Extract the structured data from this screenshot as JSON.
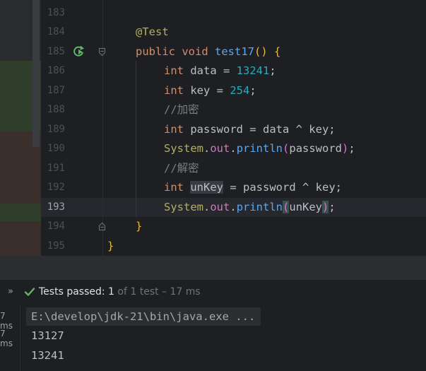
{
  "editor": {
    "line_numbers": [
      "183",
      "184",
      "185",
      "186",
      "187",
      "188",
      "189",
      "190",
      "191",
      "192",
      "193",
      "194",
      "195"
    ],
    "lines": {
      "l184_annotation": "@Test",
      "l185_public": "public",
      "l185_void": "void",
      "l185_name": "test17",
      "l185_parens": "()",
      "l185_brace": "{",
      "l186_type": "int",
      "l186_rest": " data = ",
      "l186_num": "13241",
      "l186_end": ";",
      "l187_type": "int",
      "l187_rest": " key = ",
      "l187_num": "254",
      "l187_end": ";",
      "l188_comment": "//加密",
      "l189_type": "int",
      "l189_rest": " password = data ^ key;",
      "l190_system": "System",
      "l190_dot1": ".",
      "l190_out": "out",
      "l190_dot2": ".",
      "l190_println": "println",
      "l190_lparen": "(",
      "l190_arg": "password",
      "l190_rparen": ")",
      "l190_end": ";",
      "l191_comment": "//解密",
      "l192_type": "int",
      "l192_sp": " ",
      "l192_var": "unKey",
      "l192_rest": " = password ^ key;",
      "l193_system": "System",
      "l193_dot1": ".",
      "l193_out": "out",
      "l193_dot2": ".",
      "l193_println": "println",
      "l193_lparen": "(",
      "l193_arg": "unKey",
      "l193_rparen": ")",
      "l193_end": ";",
      "l194_brace": "}",
      "l195_brace": "}"
    },
    "active_line": "193",
    "icons": {
      "run": "run-test-icon",
      "fold": "fold-icon"
    }
  },
  "results": {
    "expand_icon": "»",
    "status_label": "Tests passed: ",
    "status_count": "1",
    "status_detail": " of 1 test – 17 ms",
    "check_icon": "check-icon",
    "times": [
      "7 ms",
      "7 ms"
    ]
  },
  "output": {
    "command": "E:\\develop\\jdk-21\\bin\\java.exe ...",
    "lines": [
      "13127",
      "13241"
    ]
  },
  "colors": {
    "keyword": "#cf8e6d",
    "annotation": "#b3ae60",
    "function": "#56a8f5",
    "number": "#2aacb8",
    "comment": "#7a7e85",
    "success": "#5fb865"
  }
}
